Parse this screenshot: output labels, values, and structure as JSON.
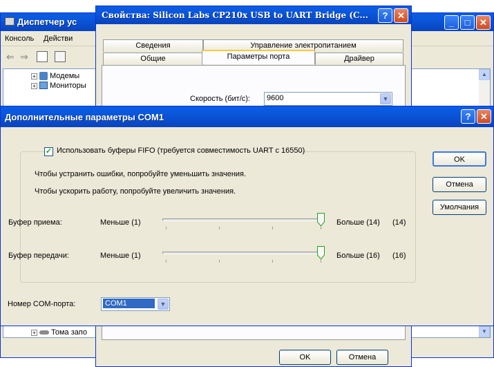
{
  "device_manager": {
    "title": "Диспетчер ус",
    "menu": [
      "Консоль",
      "Действи"
    ],
    "tree_top": [
      {
        "label": "Модемы",
        "icon": "modem-icon"
      },
      {
        "label": "Мониторы",
        "icon": "monitor-icon"
      }
    ],
    "tree_bottom": {
      "label": "Тома запо",
      "icon": "drive-icon"
    }
  },
  "properties": {
    "title": "Свойства: Silicon Labs CP210x USB to UART Bridge (C...",
    "tabs_row1": [
      "Сведения",
      "Управление электропитанием"
    ],
    "tabs_row2": [
      "Общие",
      "Параметры порта",
      "Драйвер"
    ],
    "active_tab": "Параметры порта",
    "speed_label": "Скорость (бит/с):",
    "speed_value": "9600",
    "ok_label": "OK",
    "cancel_label": "Отмена"
  },
  "advanced": {
    "title": "Дополнительные параметры COM1",
    "fifo_label": "Использовать буферы FIFO (требуется совместимость UART с 16550)",
    "fifo_checked": true,
    "hint_errors": "Чтобы устранить ошибки, попробуйте уменьшить значения.",
    "hint_speed": "Чтобы ускорить работу, попробуйте увеличить значения.",
    "receive": {
      "label": "Буфер приема:",
      "min": "Меньше (1)",
      "max": "Больше (14)",
      "current": "(14)",
      "value": 14,
      "range": [
        1,
        14
      ]
    },
    "transmit": {
      "label": "Буфер передачи:",
      "min": "Меньше (1)",
      "max": "Больше (16)",
      "current": "(16)",
      "value": 16,
      "range": [
        1,
        16
      ]
    },
    "com_label": "Номер COM-порта:",
    "com_value": "COM1",
    "ok_label": "OK",
    "cancel_label": "Отмена",
    "defaults_label": "Умолчания"
  },
  "colors": {
    "title_blue": "#0a5ee6",
    "dialog_face": "#ece9d8",
    "close_red": "#d04a21",
    "tab_highlight": "#ffc83c",
    "selection": "#316ac5"
  }
}
